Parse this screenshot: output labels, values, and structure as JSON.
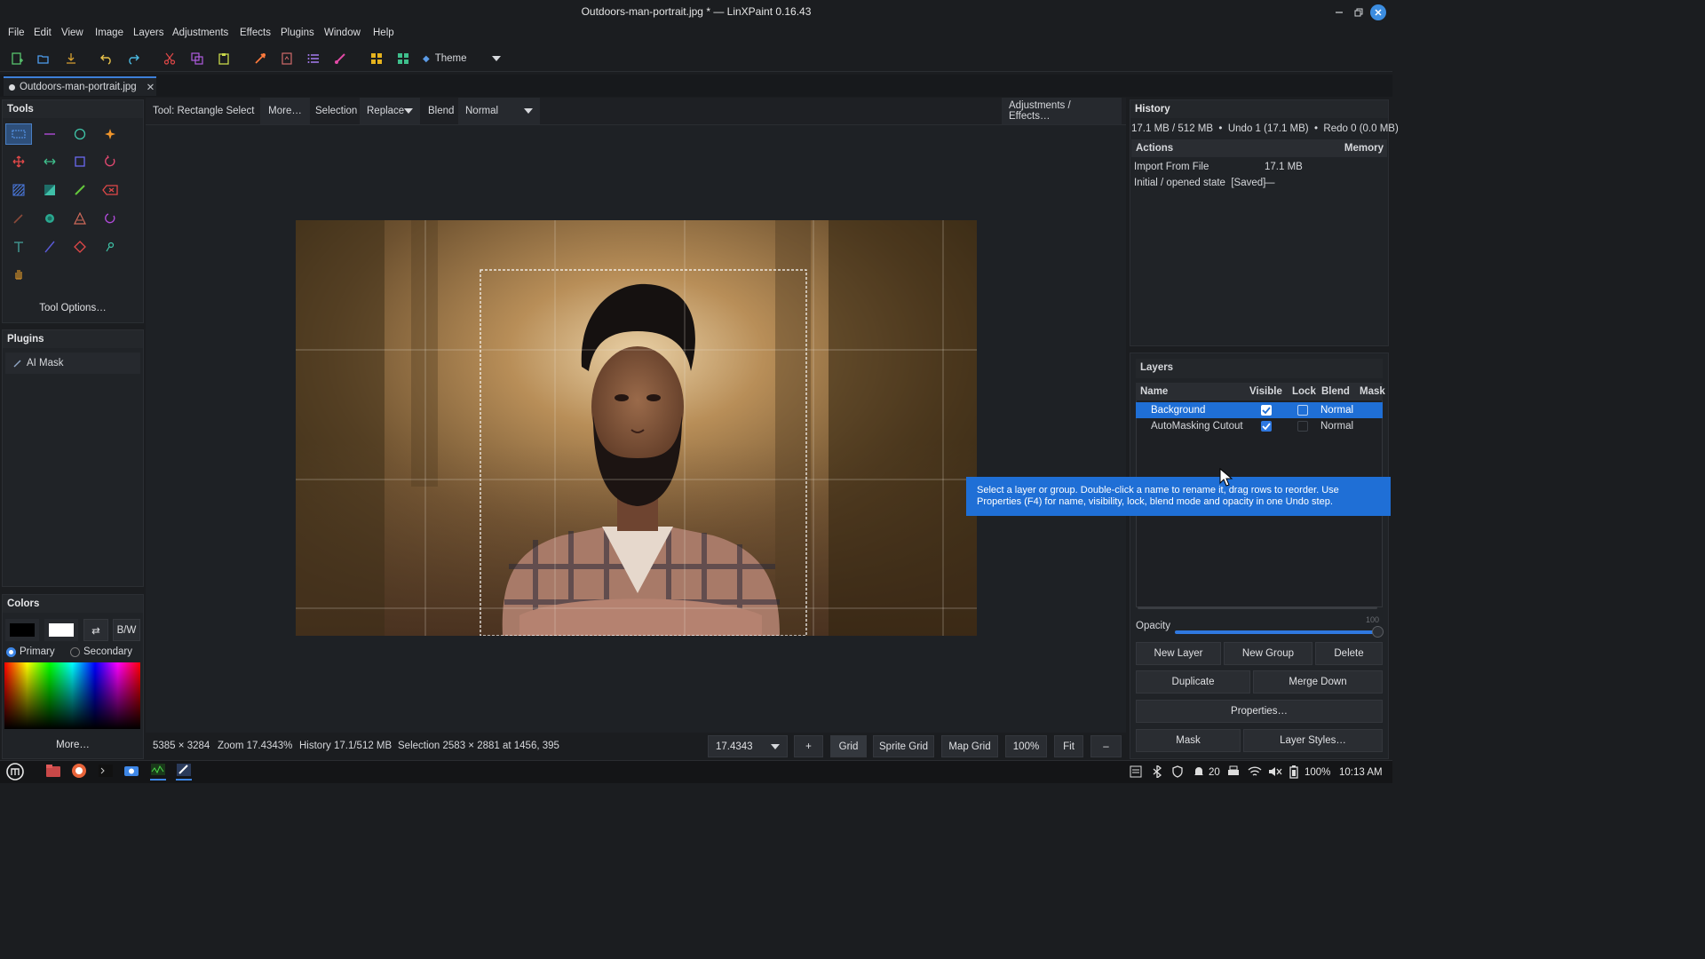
{
  "window": {
    "title": "Outdoors-man-portrait.jpg * — LinXPaint 0.16.43"
  },
  "menu": [
    "File",
    "Edit",
    "View",
    "Image",
    "Layers",
    "Adjustments",
    "Effects",
    "Plugins",
    "Window",
    "Help"
  ],
  "toolbar": {
    "theme_label": "Theme"
  },
  "doc_tab": {
    "label": "Outdoors-man-portrait.jpg"
  },
  "options_bar": {
    "tool_label": "Tool: Rectangle Select",
    "more": "More…",
    "selection_label": "Selection",
    "selection_mode": "Replace",
    "blend_label": "Blend",
    "blend_mode": "Normal",
    "adjustments_button": "Adjustments / Effects…"
  },
  "tools_panel": {
    "title": "Tools",
    "tool_options": "Tool Options…"
  },
  "plugins_panel": {
    "title": "Plugins",
    "items": [
      "AI Mask"
    ]
  },
  "colors_panel": {
    "title": "Colors",
    "swap": "⇄",
    "bw": "B/W",
    "primary": "Primary",
    "secondary": "Secondary",
    "more": "More…",
    "primary_color": "#000000",
    "secondary_color": "#ffffff"
  },
  "history_panel": {
    "title": "History",
    "summary": "17.1 MB / 512 MB  •  Undo 1 (17.1 MB)  •  Redo 0 (0.0 MB)",
    "col_actions": "Actions",
    "col_memory": "Memory",
    "rows": [
      {
        "action": "Import From File",
        "memory": "17.1 MB"
      },
      {
        "action": "Initial / opened state  [Saved]",
        "memory": "—"
      }
    ]
  },
  "layers_panel": {
    "title": "Layers",
    "cols": {
      "name": "Name",
      "visible": "Visible",
      "lock": "Lock",
      "blend": "Blend",
      "mask": "Mask"
    },
    "rows": [
      {
        "name": "Background",
        "visible": true,
        "lock": false,
        "blend": "Normal",
        "selected": true
      },
      {
        "name": "AutoMasking Cutout",
        "visible": true,
        "lock": false,
        "blend": "Normal",
        "selected": false
      }
    ],
    "tooltip": "Select a layer or group. Double-click a name to rename it, drag rows to reorder. Use Properties (F4) for name, visibility, lock, blend mode and opacity in one Undo step.",
    "opacity_label": "Opacity",
    "opacity_value": "100",
    "buttons": {
      "new_layer": "New Layer",
      "new_group": "New Group",
      "delete": "Delete",
      "duplicate": "Duplicate",
      "merge_down": "Merge Down",
      "properties": "Properties…",
      "mask": "Mask",
      "layer_styles": "Layer Styles…"
    }
  },
  "status": {
    "dimensions": "5385 × 3284",
    "zoom": "Zoom 17.4343%",
    "history": "History 17.1/512 MB",
    "selection": "Selection 2583 × 2881 at 1456, 395",
    "zoom_field": "17.4343",
    "plus": "+",
    "grid": "Grid",
    "sprite_grid": "Sprite Grid",
    "map_grid": "Map Grid",
    "hundred": "100%",
    "fit": "Fit",
    "minus": "–"
  },
  "taskbar": {
    "count": "20",
    "battery": "100%",
    "time": "10:13 AM"
  }
}
